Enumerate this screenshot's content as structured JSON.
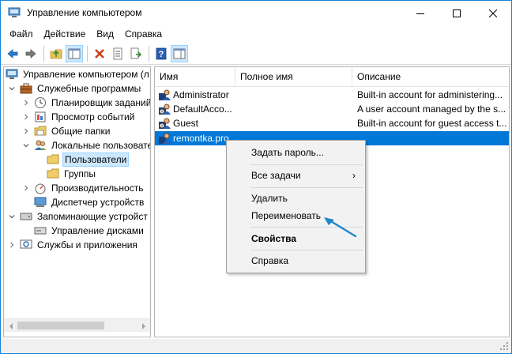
{
  "window": {
    "title": "Управление компьютером",
    "controls": {
      "minimize": "minimize",
      "maximize": "maximize",
      "close": "close"
    }
  },
  "menu": [
    {
      "label": "Файл"
    },
    {
      "label": "Действие"
    },
    {
      "label": "Вид"
    },
    {
      "label": "Справка"
    }
  ],
  "toolbar": {
    "buttons": [
      "back-arrow-icon",
      "forward-arrow-icon",
      "up-folder-icon",
      "show-tree-icon",
      "delete-icon",
      "properties-icon",
      "export-icon",
      "help-icon",
      "action-pane-icon"
    ]
  },
  "tree": {
    "items": [
      {
        "label": "Управление компьютером (л",
        "level": 0,
        "expander": "expanded"
      },
      {
        "label": "Служебные программы",
        "level": 1,
        "expander": "expanded"
      },
      {
        "label": "Планировщик заданий",
        "level": 2,
        "expander": "collapsed"
      },
      {
        "label": "Просмотр событий",
        "level": 2,
        "expander": "collapsed"
      },
      {
        "label": "Общие папки",
        "level": 2,
        "expander": "collapsed"
      },
      {
        "label": "Локальные пользовате",
        "level": 2,
        "expander": "expanded"
      },
      {
        "label": "Пользователи",
        "level": 3,
        "expander": "none",
        "selected": true
      },
      {
        "label": "Группы",
        "level": 3,
        "expander": "none"
      },
      {
        "label": "Производительность",
        "level": 2,
        "expander": "collapsed"
      },
      {
        "label": "Диспетчер устройств",
        "level": 2,
        "expander": "none"
      },
      {
        "label": "Запоминающие устройст",
        "level": 1,
        "expander": "expanded"
      },
      {
        "label": "Управление дисками",
        "level": 2,
        "expander": "none"
      },
      {
        "label": "Службы и приложения",
        "level": 1,
        "expander": "collapsed"
      }
    ]
  },
  "list": {
    "columns": [
      "Имя",
      "Полное имя",
      "Описание"
    ],
    "rows": [
      {
        "name": "Administrator",
        "fullname": "",
        "description": "Built-in account for administering..."
      },
      {
        "name": "DefaultAcco...",
        "fullname": "",
        "description": "A user account managed by the s..."
      },
      {
        "name": "Guest",
        "fullname": "",
        "description": "Built-in account for guest access t..."
      },
      {
        "name": "remontka.pro",
        "fullname": "",
        "description": "",
        "selected": true
      }
    ]
  },
  "context_menu": {
    "items": [
      {
        "label": "Задать пароль..."
      },
      {
        "label": "Все задачи",
        "submenu": true
      },
      {
        "label": "Удалить"
      },
      {
        "label": "Переименовать"
      },
      {
        "label": "Свойства",
        "bold": true
      },
      {
        "label": "Справка"
      }
    ],
    "submenu_glyph": "›"
  },
  "colors": {
    "accent": "#0078d7",
    "selection_light": "#cce8ff",
    "annotation_arrow": "#1e88c8"
  }
}
